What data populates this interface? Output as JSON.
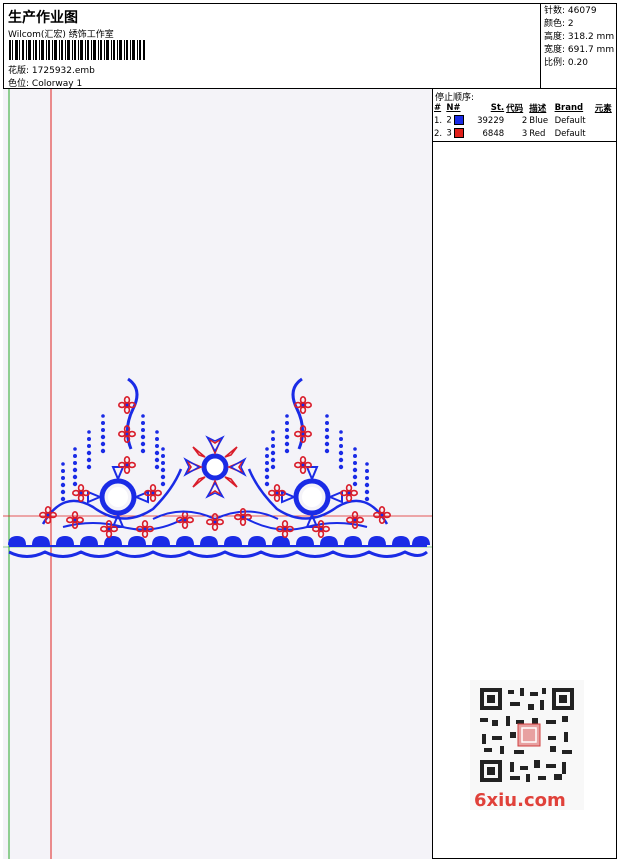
{
  "header": {
    "title": "生产作业图",
    "company": "Wilcom(汇宏) 绣饰工作室",
    "design_label": "花版:",
    "design_value": "1725932.emb",
    "colorway_label": "色位:",
    "colorway_value": "Colorway 1"
  },
  "specs": {
    "stitches_label": "针数:",
    "stitches_value": "46079",
    "colors_label": "颜色:",
    "colors_value": "2",
    "height_label": "高度:",
    "height_value": "318.2 mm",
    "width_label": "宽度:",
    "width_value": "691.7 mm",
    "scale_label": "比例:",
    "scale_value": "0.20"
  },
  "stop_sequence": {
    "title": "停止顺序:",
    "headers": [
      "#",
      "N#",
      "St.",
      "代码",
      "描述",
      "Brand",
      "元素"
    ],
    "rows": [
      {
        "idx": "1.",
        "n": "2",
        "color": "#1a2be6",
        "stitches": "39229",
        "code": "2",
        "desc": "Blue",
        "brand": "Default"
      },
      {
        "idx": "2.",
        "n": "3",
        "color": "#e0201a",
        "stitches": "6848",
        "code": "3",
        "desc": "Red",
        "brand": "Default"
      }
    ]
  },
  "watermark": {
    "site": "6xiu.com"
  },
  "colors": {
    "blue": "#1a2be6",
    "red": "#d91c2a",
    "guide_red": "#e02020",
    "guide_green": "#2aa82a"
  }
}
